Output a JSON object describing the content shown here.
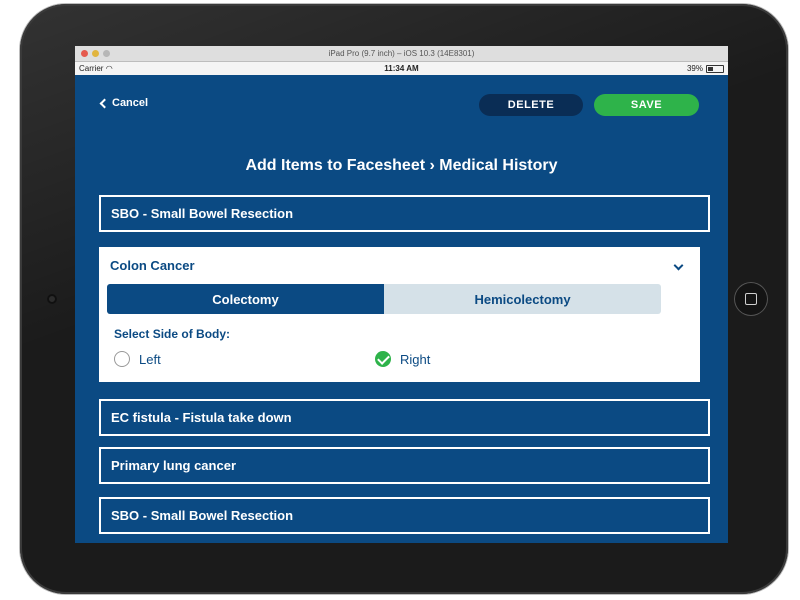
{
  "simulator": {
    "title": "iPad Pro (9.7 inch) – iOS 10.3 (14E8301)"
  },
  "status_bar": {
    "carrier": "Carrier",
    "time": "11:34 AM",
    "battery": "39%",
    "battery_level": 0.39
  },
  "header": {
    "cancel_label": "Cancel",
    "delete_label": "DELETE",
    "save_label": "SAVE",
    "title": "Add Items to Facesheet › Medical History"
  },
  "items": [
    {
      "label": "SBO - Small Bowel Resection"
    },
    {
      "label": "Colon Cancer"
    },
    {
      "label": "EC fistula - Fistula take down"
    },
    {
      "label": "Primary lung cancer"
    },
    {
      "label": "SBO - Small Bowel Resection"
    }
  ],
  "expanded": {
    "segments": [
      "Colectomy",
      "Hemicolectomy"
    ],
    "selected_segment": "Colectomy",
    "side_label": "Select Side of Body:",
    "options": [
      {
        "label": "Left",
        "checked": false
      },
      {
        "label": "Right",
        "checked": true
      }
    ]
  },
  "colors": {
    "primary": "#0b4a83",
    "accent_green": "#2eb34a",
    "delete_bg": "#0a2d55",
    "segment_inactive": "#d5e1e8"
  }
}
